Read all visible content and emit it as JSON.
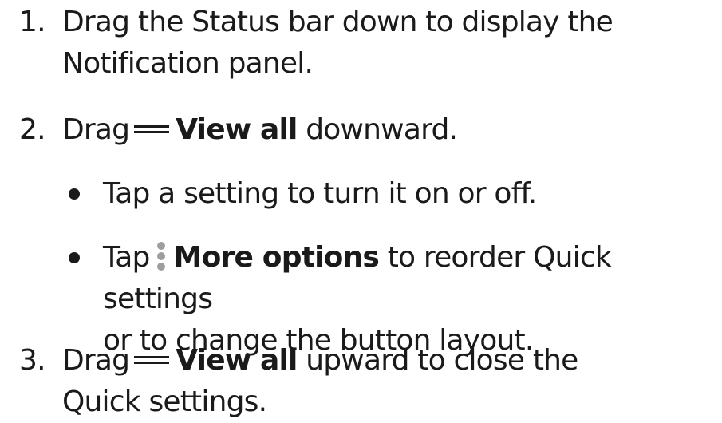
{
  "steps": [
    {
      "number": "1.",
      "line1": "Drag the Status bar down to display the",
      "line2": "Notification panel."
    },
    {
      "number": "2.",
      "prefix": "Drag",
      "icon": "drag-handle-icon",
      "bold": "View all",
      "suffix": " downward."
    },
    {
      "number": "3.",
      "prefix": "Drag",
      "icon": "drag-handle-icon",
      "bold": "View all",
      "suffix": " upward to close the",
      "line2": "Quick settings."
    }
  ],
  "bullets": [
    {
      "text": "Tap a setting to turn it on or off."
    },
    {
      "prefix": "Tap",
      "icon": "more-options-icon",
      "bold": "More options",
      "suffix": " to reorder Quick settings",
      "line2": "or to change the button layout."
    }
  ]
}
